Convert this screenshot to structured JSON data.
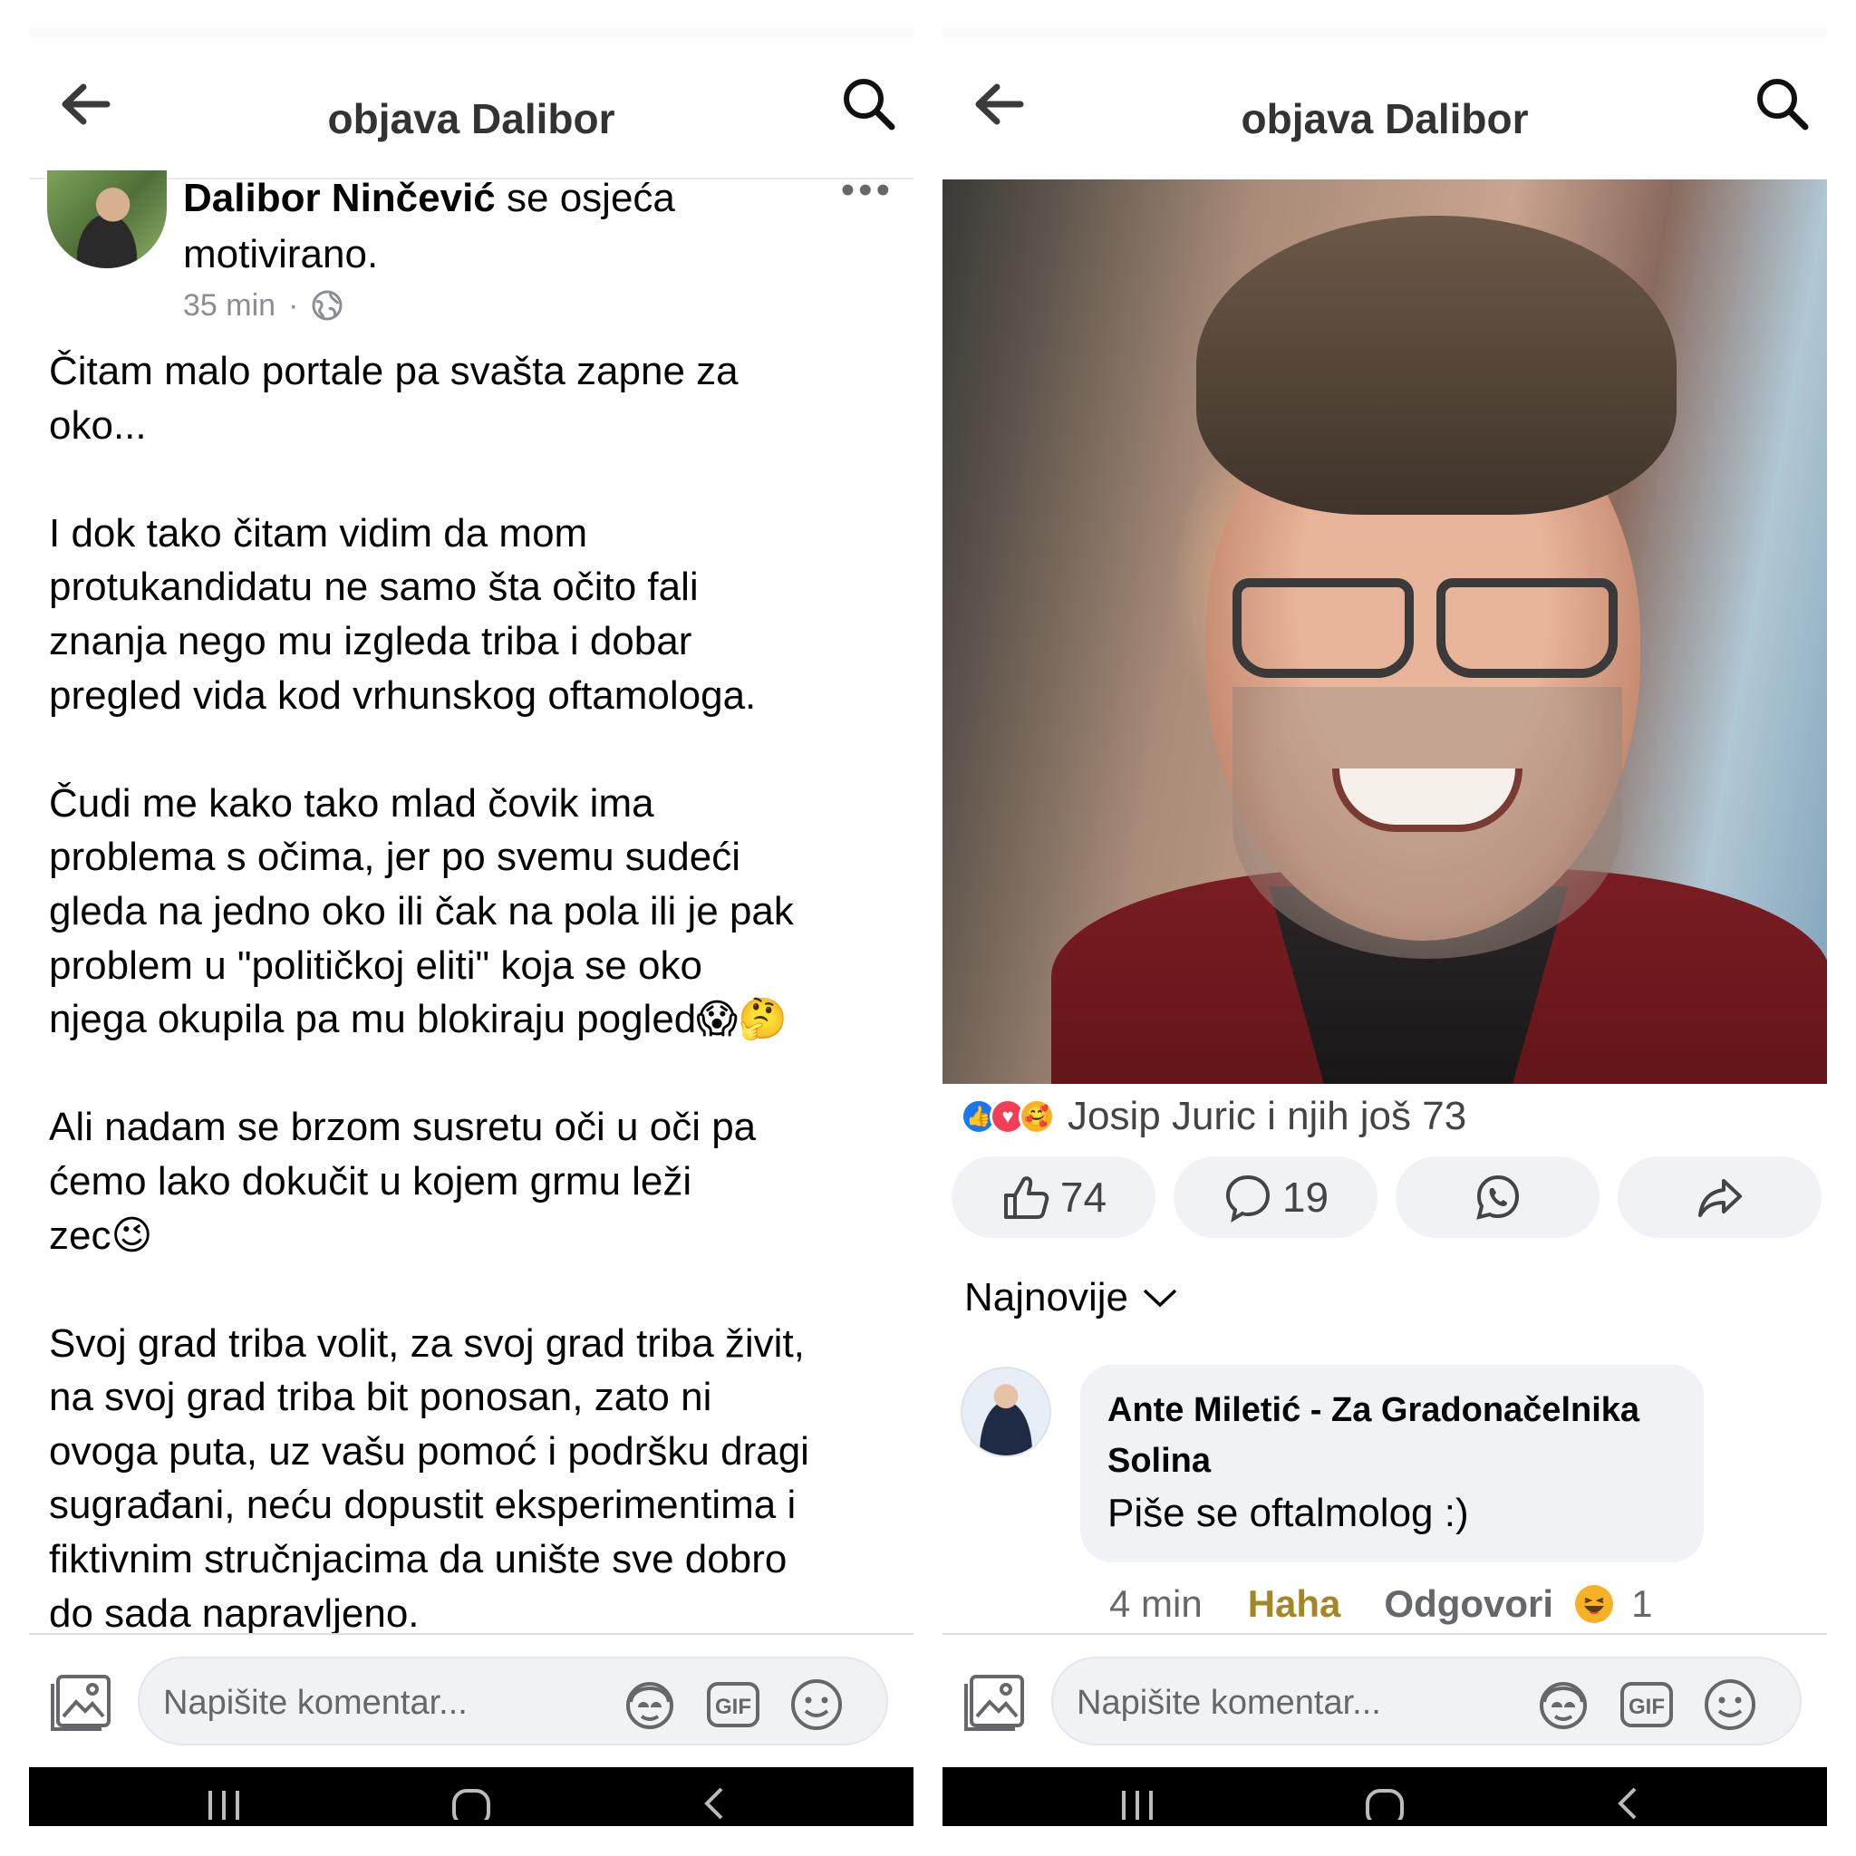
{
  "left": {
    "appbar": {
      "title": "objava Dalibor"
    },
    "post": {
      "author": "Dalibor Ninčević",
      "feeling_line1": " se osjeća",
      "feeling_line2": "motivirano.",
      "time": "35 min",
      "separator": "·",
      "paragraphs": [
        [
          "Čitam malo portale pa svašta zapne za",
          "oko..."
        ],
        [
          "I dok tako čitam vidim da mom",
          "protukandidatu ne samo šta očito fali",
          "znanja nego mu izgleda triba i dobar",
          "pregled vida kod vrhunskog oftamologa."
        ],
        [
          "Čudi me kako tako mlad čovik ima",
          "problema s očima, jer po svemu sudeći",
          "gleda na jedno oko ili čak na pola ili je pak",
          "problem u \"političkoj eliti\" koja se oko",
          "njega okupila pa mu blokiraju pogled😱🤔"
        ],
        [
          "Ali nadam se brzom susretu oči u oči pa",
          "ćemo lako dokučit u kojem grmu leži",
          "zec😉"
        ],
        [
          "Svoj grad triba volit, za svoj grad triba živit,",
          "na svoj grad triba bit ponosan, zato ni",
          "ovoga puta, uz vašu pomoć i podršku dragi",
          "sugrađani, neću dopustit eksperimentima i",
          "fiktivnim stručnjacima da unište sve dobro",
          "do sada napravljeno."
        ]
      ]
    },
    "composer": {
      "placeholder": "Napišite komentar..."
    }
  },
  "right": {
    "appbar": {
      "title": "objava Dalibor"
    },
    "reactions_summary": "Josip Juric i njih još 73",
    "actions": {
      "likes": "74",
      "comments": "19"
    },
    "sort_label": "Najnovije",
    "comment": {
      "author_line1": "Ante Miletić - Za Gradonačelnika",
      "author_line2": "Solina",
      "text": "Piše se oftalmolog :)",
      "time": "4 min",
      "reaction_label": "Haha",
      "reply_label": "Odgovori",
      "reaction_count": "1"
    },
    "composer": {
      "placeholder": "Napišite komentar..."
    }
  },
  "icons": {
    "back": "arrow-left-icon",
    "search": "search-icon",
    "more": "more-icon",
    "globe": "globe-icon",
    "like": "thumbs-up-icon",
    "comment": "comment-bubble-icon",
    "whatsapp": "whatsapp-icon",
    "share": "share-arrow-icon",
    "photo": "photo-icon",
    "avatar_sticker": "avatar-sticker-icon",
    "gif": "gif-icon",
    "emoji": "emoji-icon"
  },
  "colors": {
    "reaction_haha": "#a58624",
    "like_blue": "#1877f2",
    "love_red": "#f33e58",
    "pill_bg": "#f0f2f5"
  }
}
